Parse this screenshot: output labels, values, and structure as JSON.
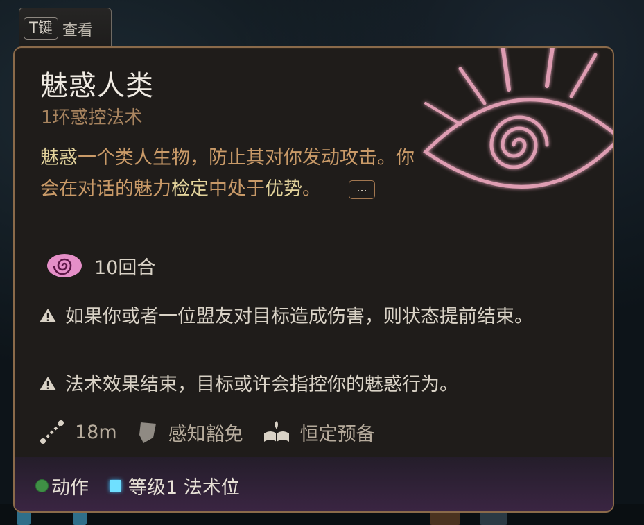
{
  "hint": {
    "key": "T键",
    "label": "查看"
  },
  "spell": {
    "title": "魅惑人类",
    "subtitle": "1环惑控法术",
    "desc": {
      "hl1": "魅惑",
      "p1": "一个类人生物，防止其对你发动攻击。你会在对话的魅力",
      "hl2": "检定",
      "p2": "中处于",
      "hl3": "优势",
      "p3": "。"
    },
    "more_label": "...",
    "duration": "10回合",
    "warnings": [
      "如果你或者一位盟友对目标造成伤害，则状态提前结束。",
      "法术效果结束，目标或许会指控你的魅惑行为。"
    ],
    "properties": {
      "range": "18m",
      "save": "感知豁免",
      "prep": "恒定预备"
    },
    "costs": {
      "action": "动作",
      "slot": "等级1 法术位"
    }
  },
  "icons": {
    "eye": "charm-eye-icon",
    "spiral": "spiral-icon",
    "warning": "warning-icon",
    "range": "range-icon",
    "save": "shield-icon",
    "prep": "spellbook-icon",
    "action": "action-dot-icon",
    "slot": "spell-slot-icon"
  },
  "colors": {
    "accent_gold": "#c99a68",
    "highlight": "#e2d29b",
    "eye_pink": "#e8a0b8",
    "slot_blue": "#6fe0ff",
    "action_green": "#3f8f45"
  }
}
